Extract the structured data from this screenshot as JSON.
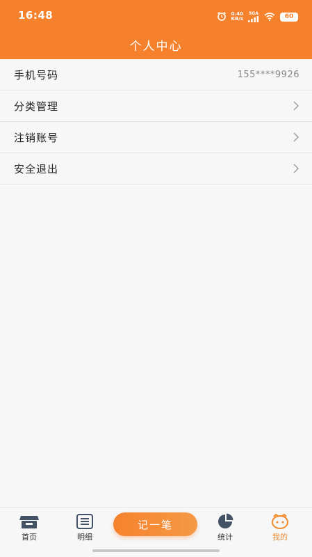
{
  "status_bar": {
    "time": "16:48",
    "net_speed_value": "0.40",
    "net_speed_unit": "KB/s",
    "signal_label": "5GA",
    "battery": "60"
  },
  "header": {
    "title": "个人中心",
    "background_color": "#f6812d"
  },
  "menu": {
    "phone": {
      "label": "手机号码",
      "value": "155****9926"
    },
    "category": {
      "label": "分类管理"
    },
    "cancel_account": {
      "label": "注销账号"
    },
    "logout": {
      "label": "安全退出"
    }
  },
  "tabbar": {
    "home": {
      "label": "首页",
      "icon": "shop-icon"
    },
    "detail": {
      "label": "明细",
      "icon": "list-icon"
    },
    "add": {
      "label": "记一笔"
    },
    "stats": {
      "label": "统计",
      "icon": "pie-chart-icon"
    },
    "mine": {
      "label": "我的",
      "icon": "face-icon",
      "active": true
    },
    "active_color": "#f08a2c"
  }
}
